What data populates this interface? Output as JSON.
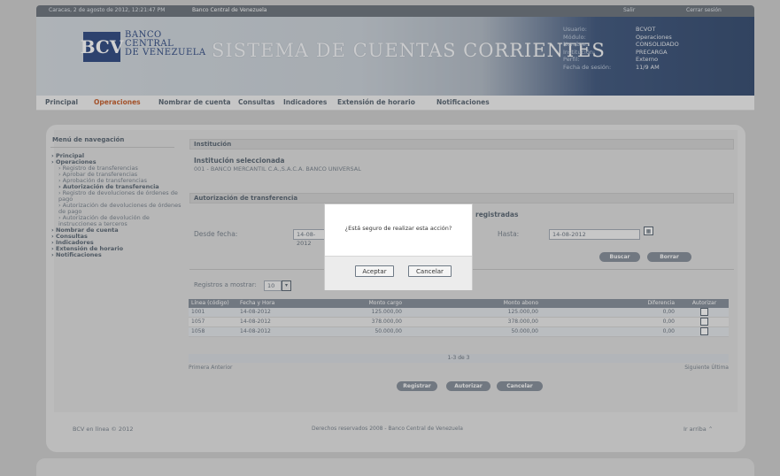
{
  "topbar": {
    "left_text": "Caracas, 2 de agosto de 2012, 12:21:47 PM",
    "center_text": "Banco Central de Venezuela",
    "link1": "Salir",
    "link2": "Cerrar sesión"
  },
  "brand": {
    "logo_initials": "BCV",
    "logo_line1": "BANCO",
    "logo_line2": "CENTRAL",
    "logo_line3": "DE VENEZUELA",
    "system_title": "SISTEMA DE CUENTAS CORRIENTES"
  },
  "user_info": [
    {
      "key": "Usuario:",
      "value": "BCVOT"
    },
    {
      "key": "Módulo:",
      "value": "Operaciones"
    },
    {
      "key": "Nombre:",
      "value": "CONSOLIDADO"
    },
    {
      "key": "Institución:",
      "value": "PRECARGA"
    },
    {
      "key": "Perfil:",
      "value": "Externo"
    },
    {
      "key": "Fecha de sesión:",
      "value": "11/9 AM"
    }
  ],
  "menu": [
    "Principal",
    "Operaciones",
    "Nombrar de cuenta",
    "Consultas",
    "Indicadores",
    "Extensión de horario",
    "Notificaciones"
  ],
  "nav": {
    "title": "Menú de navegación",
    "items": [
      {
        "label": "Principal",
        "level": 1
      },
      {
        "label": "Operaciones",
        "level": 1
      },
      {
        "label": "Registro de transferencias",
        "level": 2
      },
      {
        "label": "Aprobar de transferencias",
        "level": 2
      },
      {
        "label": "Aprobación de transferencias",
        "level": 2
      },
      {
        "label": "Autorización de transferencia",
        "level": 3
      },
      {
        "label": "Registro de devoluciones de órdenes de pago",
        "level": 2
      },
      {
        "label": "Autorización de devoluciones de órdenes de pago",
        "level": 2
      },
      {
        "label": "Autorización de devolución de instrucciones a terceros",
        "level": 2
      },
      {
        "label": "Nombrar de cuenta",
        "level": 1
      },
      {
        "label": "Consultas",
        "level": 1
      },
      {
        "label": "Indicadores",
        "level": 1
      },
      {
        "label": "Extensión de horario",
        "level": 1
      },
      {
        "label": "Notificaciones",
        "level": 1
      }
    ]
  },
  "institution": {
    "section_title": "Institución",
    "selected_label": "Institución seleccionada",
    "selected_value": "001 - BANCO MERCANTIL C.A.,S.A.C.A. BANCO UNIVERSAL"
  },
  "authorization": {
    "section_title": "Autorización de transferencia",
    "filter_heading": "registradas",
    "date_from_label": "Desde  fecha:",
    "date_from_value": "14-08-2012",
    "date_to_label": "Hasta:",
    "date_to_value": "14-08-2012",
    "search_button": "Buscar",
    "clear_button": "Borrar"
  },
  "records": {
    "label": "Registros a mostrar:",
    "value": "10"
  },
  "table": {
    "headers": [
      "Línea (código)",
      "Fecha y Hora",
      "Monto cargo",
      "Monto abono",
      "Diferencia",
      "Autorizar"
    ],
    "rows": [
      [
        "1001",
        "14-08-2012",
        "125.000,00",
        "125.000,00",
        "0,00"
      ],
      [
        "1057",
        "14-08-2012",
        "378.000,00",
        "378.000,00",
        "0,00"
      ],
      [
        "1058",
        "14-08-2012",
        "50.000,00",
        "50.000,00",
        "0,00"
      ]
    ],
    "pager": "1-3 de 3",
    "pager_left": "Primera  Anterior",
    "pager_right": "Siguiente  Última"
  },
  "actions": [
    "Registrar",
    "Autorizar",
    "Cancelar"
  ],
  "footer": {
    "left": "BCV en línea © 2012",
    "center": "Derechos reservados 2008 - Banco Central de Venezuela",
    "right": "Ir arriba ⌃"
  },
  "dialog": {
    "message": "¿Está seguro de realizar esta acción?",
    "accept": "Aceptar",
    "cancel": "Cancelar"
  }
}
